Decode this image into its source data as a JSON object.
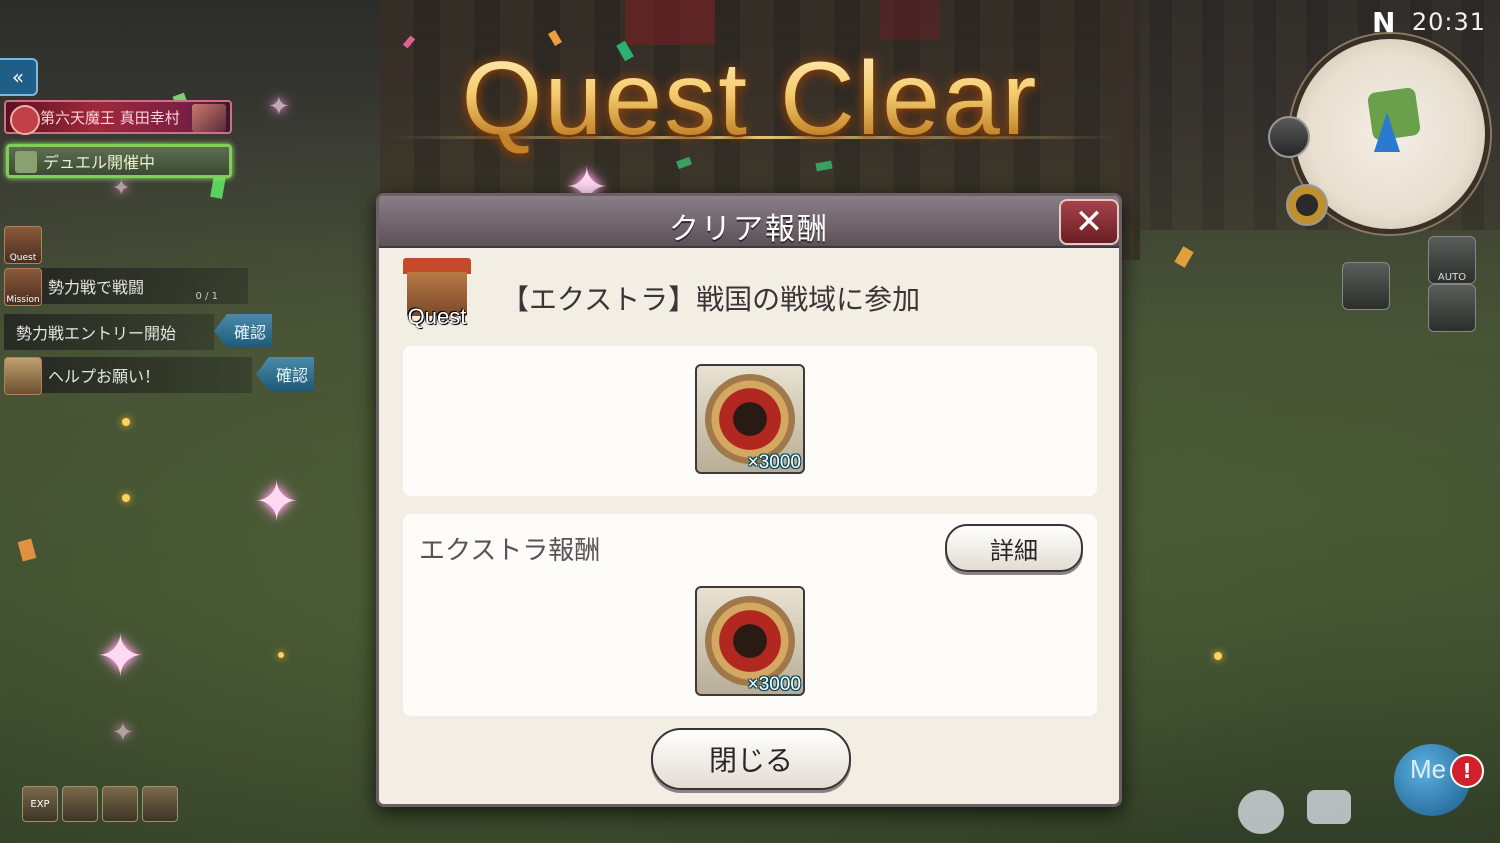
{
  "banner": {
    "title": "Quest Clear"
  },
  "hud": {
    "clock": "20:31",
    "compass": "N",
    "boss_banner": "第六天魔王 真田幸村",
    "duel_banner": "デュエル開催中",
    "quest_tab": "Quest",
    "mission_tab": "Mission",
    "mission_title": "勢力戦で戦闘",
    "mission_progress": "0 / 1",
    "entry_text": "勢力戦エントリー開始",
    "entry_button": "確認",
    "help_text": "ヘルプお願い！",
    "help_button": "確認",
    "exp_label": "EXP",
    "auto_label": "AUTO",
    "me_label": "Me",
    "alert_mark": "!"
  },
  "dialog": {
    "title": "クリア報酬",
    "close_symbol": "✕",
    "quest_icon_label": "Quest",
    "quest_name": "【エクストラ】戦国の戦域に参加",
    "reward": {
      "quantity": "×3000",
      "icon": "samurai-helmet-medal-icon"
    },
    "extra_section_label": "エクストラ報酬",
    "details_button": "詳細",
    "extra_reward": {
      "quantity": "×3000",
      "icon": "samurai-helmet-medal-icon"
    },
    "close_button": "閉じる"
  },
  "colors": {
    "accent_gold": "#f4cc6e",
    "dialog_bg": "#f3eee3",
    "header": "#6e5e66",
    "check_blue": "#1e5a78"
  }
}
